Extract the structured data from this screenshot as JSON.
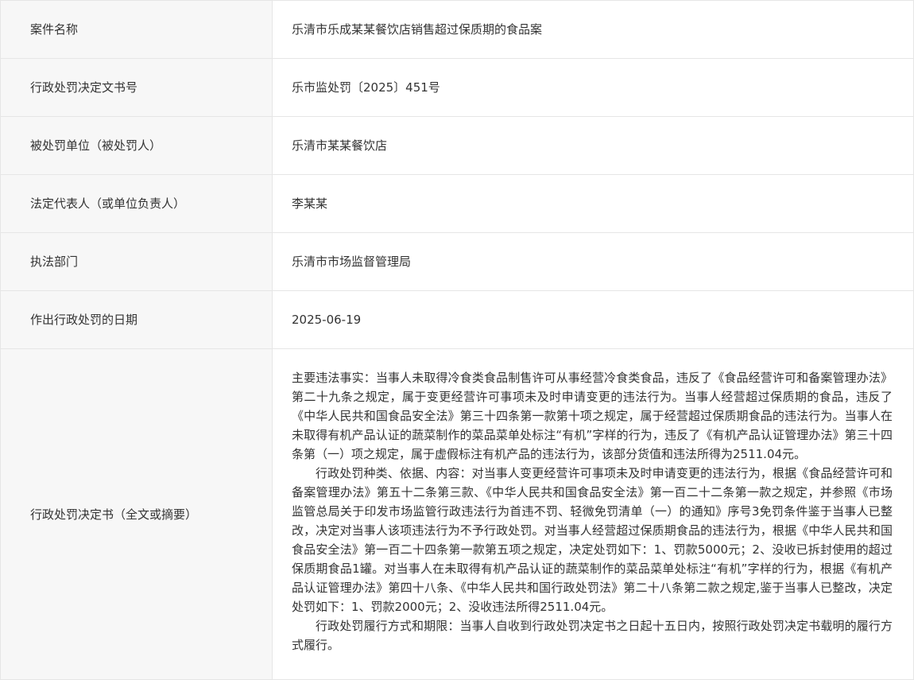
{
  "rows": [
    {
      "label": "案件名称",
      "value": "乐清市乐成某某餐饮店销售超过保质期的食品案"
    },
    {
      "label": "行政处罚决定文书号",
      "value": "乐市监处罚〔2025〕451号"
    },
    {
      "label": "被处罚单位（被处罚人）",
      "value": "乐清市某某餐饮店"
    },
    {
      "label": "法定代表人（或单位负责人）",
      "value": "李某某"
    },
    {
      "label": "执法部门",
      "value": "乐清市市场监督管理局"
    },
    {
      "label": "作出行政处罚的日期",
      "value": "2025-06-19"
    }
  ],
  "decision": {
    "label": "行政处罚决定书（全文或摘要）",
    "paragraphs": [
      "主要违法事实：当事人未取得冷食类食品制售许可从事经营冷食类食品，违反了《食品经营许可和备案管理办法》第二十九条之规定，属于变更经营许可事项未及时申请变更的违法行为。当事人经营超过保质期的食品，违反了《中华人民共和国食品安全法》第三十四条第一款第十项之规定，属于经营超过保质期食品的违法行为。当事人在未取得有机产品认证的蔬菜制作的菜品菜单处标注“有机”字样的行为，违反了《有机产品认证管理办法》第三十四条第（一）项之规定，属于虚假标注有机产品的违法行为，该部分货值和违法所得为2511.04元。",
      "行政处罚种类、依据、内容：对当事人变更经营许可事项未及时申请变更的违法行为，根据《食品经营许可和备案管理办法》第五十二条第三款、《中华人民共和国食品安全法》第一百二十二条第一款之规定，并参照《市场监管总局关于印发市场监管行政违法行为首违不罚、轻微免罚清单（一）的通知》序号3免罚条件鉴于当事人已整改，决定对当事人该项违法行为不予行政处罚。对当事人经营超过保质期食品的违法行为，根据《中华人民共和国食品安全法》第一百二十四条第一款第五项之规定，决定处罚如下：1、罚款5000元；2、没收已拆封使用的超过保质期食品1罐。对当事人在未取得有机产品认证的蔬菜制作的菜品菜单处标注“有机”字样的行为，根据《有机产品认证管理办法》第四十八条、《中华人民共和国行政处罚法》第二十八条第二款之规定,鉴于当事人已整改，决定处罚如下：1、罚款2000元；2、没收违法所得2511.04元。",
      "行政处罚履行方式和期限：当事人自收到行政处罚决定书之日起十五日内，按照行政处罚决定书载明的履行方式履行。"
    ]
  }
}
